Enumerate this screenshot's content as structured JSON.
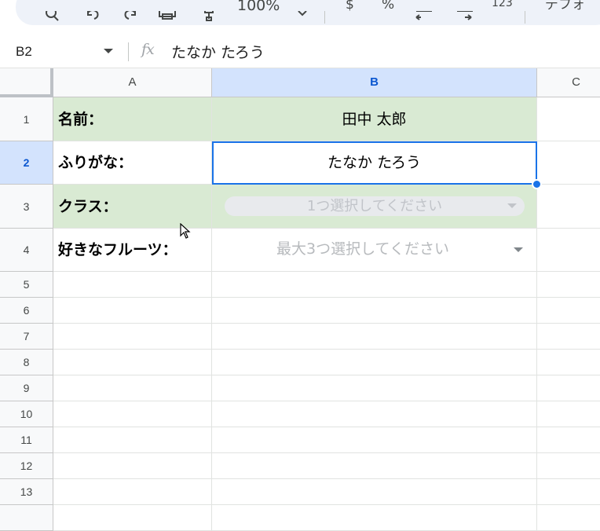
{
  "toolbar": {
    "zoom": "100%",
    "percent": "%",
    "number_format": "123",
    "font_partial": "デフォ"
  },
  "formula_bar": {
    "cell_ref": "B2",
    "fx": "fx",
    "value": "たなか たろう"
  },
  "columns": [
    "A",
    "B",
    "C"
  ],
  "rows": [
    "1",
    "2",
    "3",
    "4",
    "5",
    "6",
    "7",
    "8",
    "9",
    "10",
    "11",
    "12",
    "13"
  ],
  "cells": {
    "A1": "名前：",
    "A2": "ふりがな：",
    "A3": "クラス：",
    "A4": "好きなフルーツ：",
    "B1": "田中 太郎",
    "B2": "たなか たろう",
    "B3_placeholder": "1つ選択してください",
    "B4_placeholder": "最大3つ選択してください"
  },
  "colors": {
    "label_fill": "#d9ead3",
    "selection": "#1a73e8",
    "header_selected": "#d3e3fd"
  }
}
